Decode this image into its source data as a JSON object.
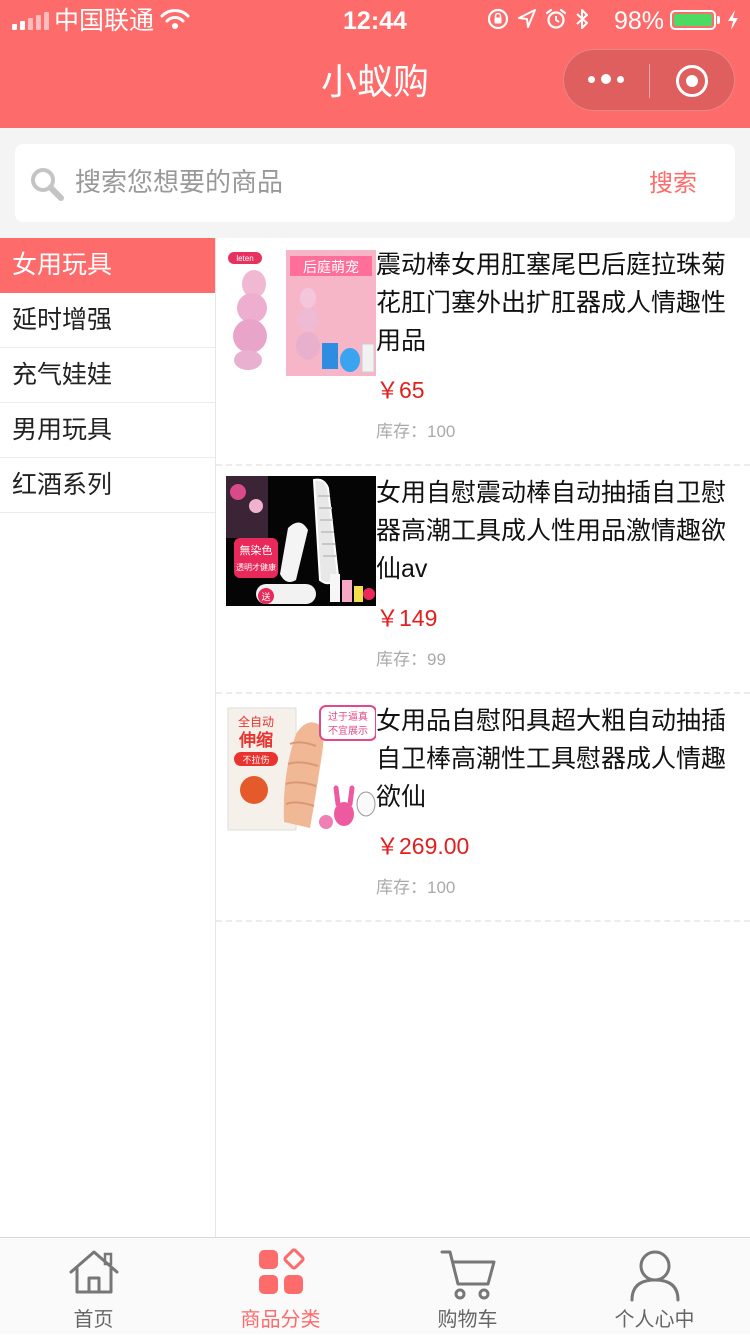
{
  "status_bar": {
    "carrier": "中国联通",
    "time": "12:44",
    "battery": "98%"
  },
  "nav": {
    "title": "小蚁购"
  },
  "search": {
    "placeholder": "搜索您想要的商品",
    "button": "搜索"
  },
  "categories": [
    {
      "label": "女用玩具",
      "active": true
    },
    {
      "label": "延时增强",
      "active": false
    },
    {
      "label": "充气娃娃",
      "active": false
    },
    {
      "label": "男用玩具",
      "active": false
    },
    {
      "label": "红酒系列",
      "active": false
    }
  ],
  "products": [
    {
      "name": "震动棒女用肛塞尾巴后庭拉珠菊花肛门塞外出扩肛器成人情趣性用品",
      "price": "￥65",
      "stock": "库存：100",
      "thumb_label": "后庭萌宠",
      "thumb_brand": "leten"
    },
    {
      "name": "女用自慰震动棒自动抽插自卫慰器高潮工具成人性用品激情趣欲仙av",
      "price": "￥149",
      "stock": "库存：99",
      "thumb_label": "無染色",
      "thumb_label2": "透明才健康",
      "thumb_tag": "送"
    },
    {
      "name": "女用品自慰阳具超大粗自动抽插自卫棒高潮性工具慰器成人情趣欲仙",
      "price": "￥269.00",
      "stock": "库存：100",
      "thumb_label": "全自动",
      "thumb_label2": "伸缩",
      "thumb_label3": "不拉伤",
      "thumb_label4": "过于逼真",
      "thumb_label5": "不宜展示"
    }
  ],
  "tabbar": [
    {
      "label": "首页",
      "icon": "home-icon",
      "active": false
    },
    {
      "label": "商品分类",
      "icon": "category-icon",
      "active": true
    },
    {
      "label": "购物车",
      "icon": "cart-icon",
      "active": false
    },
    {
      "label": "个人心中",
      "icon": "user-icon",
      "active": false
    }
  ],
  "colors": {
    "brand": "#fe6b6b",
    "price": "#e02020",
    "battery": "#4cd964"
  }
}
